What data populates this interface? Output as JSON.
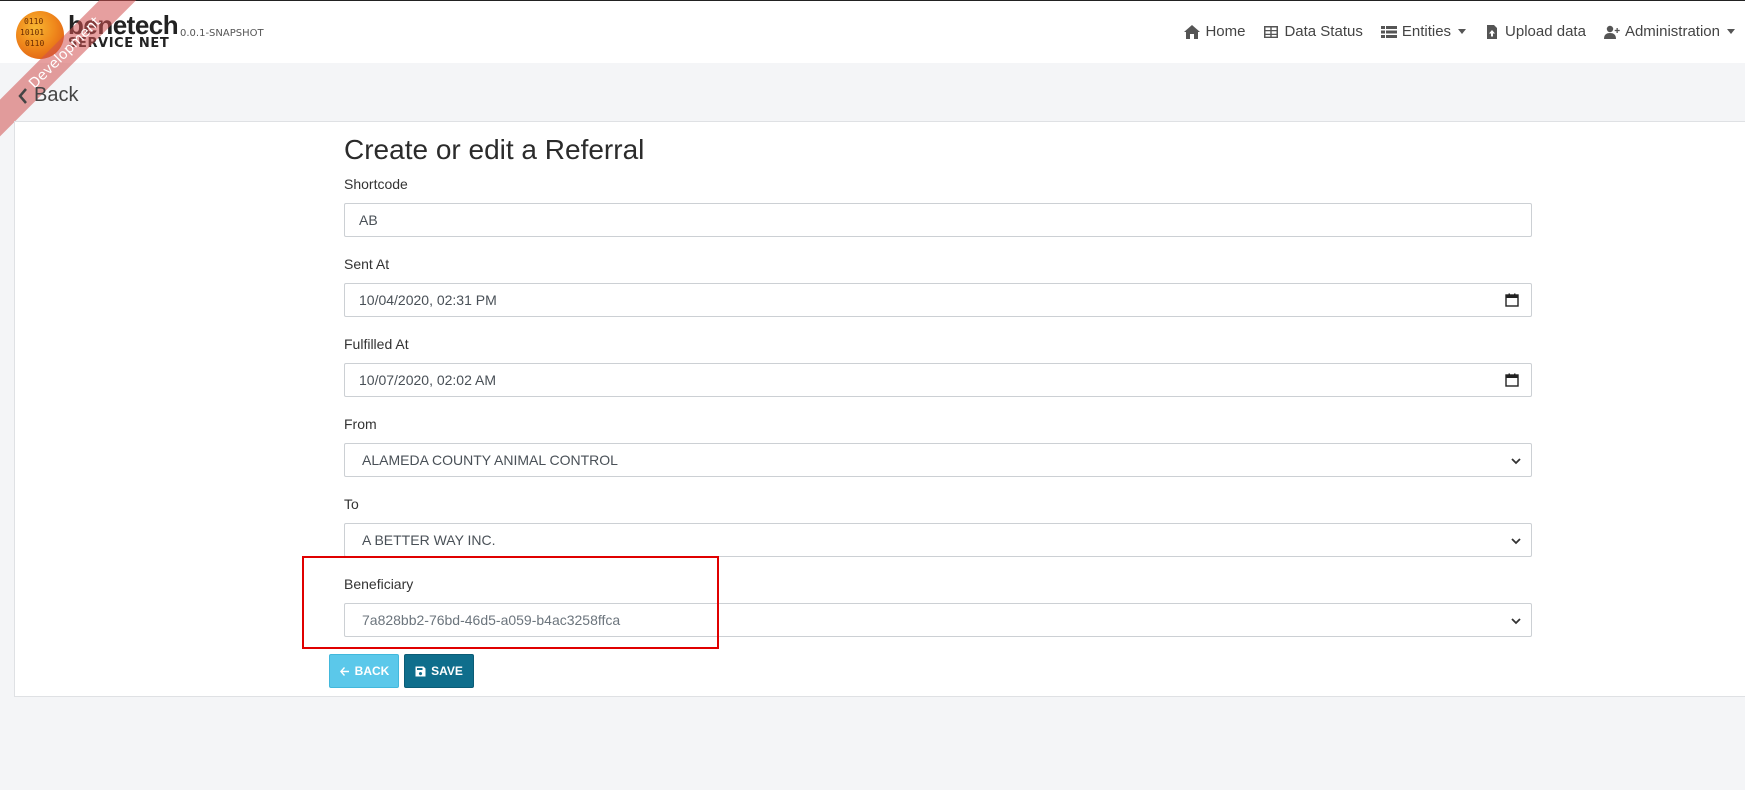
{
  "header": {
    "brand_top": "benetech",
    "brand_bottom": "SERVICE NET",
    "version": "0.0.1-SNAPSHOT",
    "ribbon": "Development",
    "nav": {
      "home": "Home",
      "data_status": "Data Status",
      "entities": "Entities",
      "upload_data": "Upload data",
      "administration": "Administration"
    }
  },
  "back_link": "Back",
  "form": {
    "title": "Create or edit a Referral",
    "shortcode": {
      "label": "Shortcode",
      "value": "AB"
    },
    "sent_at": {
      "label": "Sent At",
      "value": "10/04/2020, 02:31 PM"
    },
    "fulfilled_at": {
      "label": "Fulfilled At",
      "value": "10/07/2020, 02:02 AM"
    },
    "from": {
      "label": "From",
      "value": "ALAMEDA COUNTY ANIMAL CONTROL"
    },
    "to": {
      "label": "To",
      "value": "A BETTER WAY INC."
    },
    "beneficiary": {
      "label": "Beneficiary",
      "value": "7a828bb2-76bd-46d5-a059-b4ac3258ffca"
    }
  },
  "buttons": {
    "back": "Back",
    "save": "Save"
  },
  "colors": {
    "highlight": "#e00000",
    "save_button": "#0f6e8c",
    "back_button": "#5bc8ea"
  },
  "icons": [
    "home-icon",
    "table-icon",
    "list-icon",
    "file-upload-icon",
    "user-plus-icon",
    "chevron-left-icon",
    "calendar-icon",
    "chevron-down-icon",
    "arrow-left-icon",
    "save-icon"
  ]
}
